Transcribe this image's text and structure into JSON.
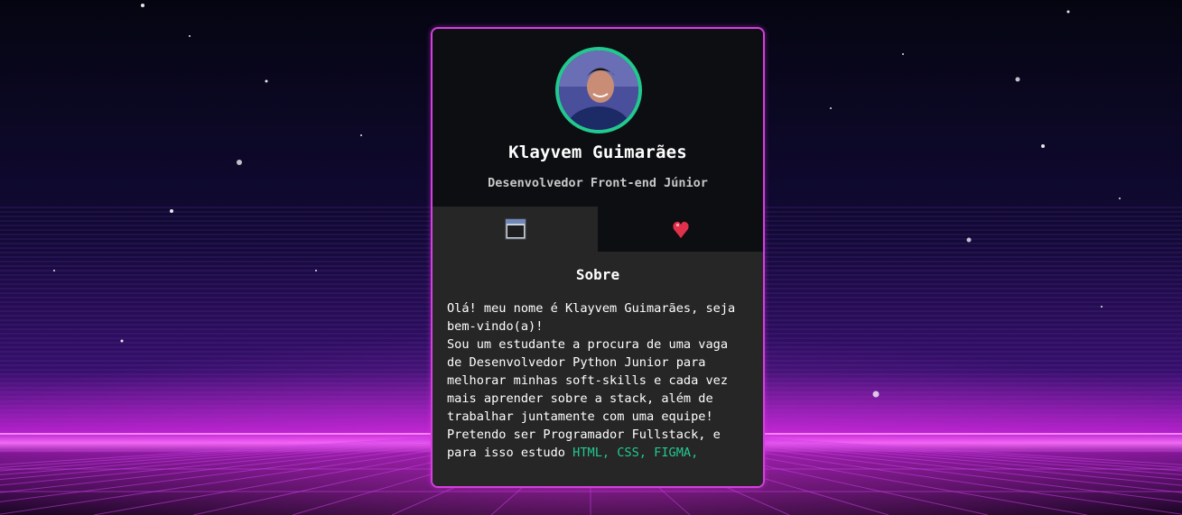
{
  "profile": {
    "name": "Klayvem Guimarães",
    "role": "Desenvolvedor Front-end Júnior"
  },
  "tabs": [
    {
      "icon": "window-icon",
      "active": true
    },
    {
      "icon": "heart-icon",
      "active": false
    }
  ],
  "about": {
    "title": "Sobre",
    "line1": "Olá! meu nome é Klayvem Guimarães, seja bem-vindo(a)!",
    "line2": "Sou um estudante a procura de uma vaga de Desenvolvedor Python Junior para melhorar minhas soft-skills e cada vez mais aprender sobre a stack, além de trabalhar juntamente com uma equipe!",
    "line3": "Pretendo ser Programador Fullstack, e para isso estudo",
    "highlight": "HTML, CSS, FIGMA,"
  },
  "colors": {
    "accent_border": "#d63ee0",
    "avatar_ring": "#22c98e",
    "highlight_text": "#22c98e",
    "card_bg": "#0c0e11",
    "content_bg": "#262626"
  }
}
